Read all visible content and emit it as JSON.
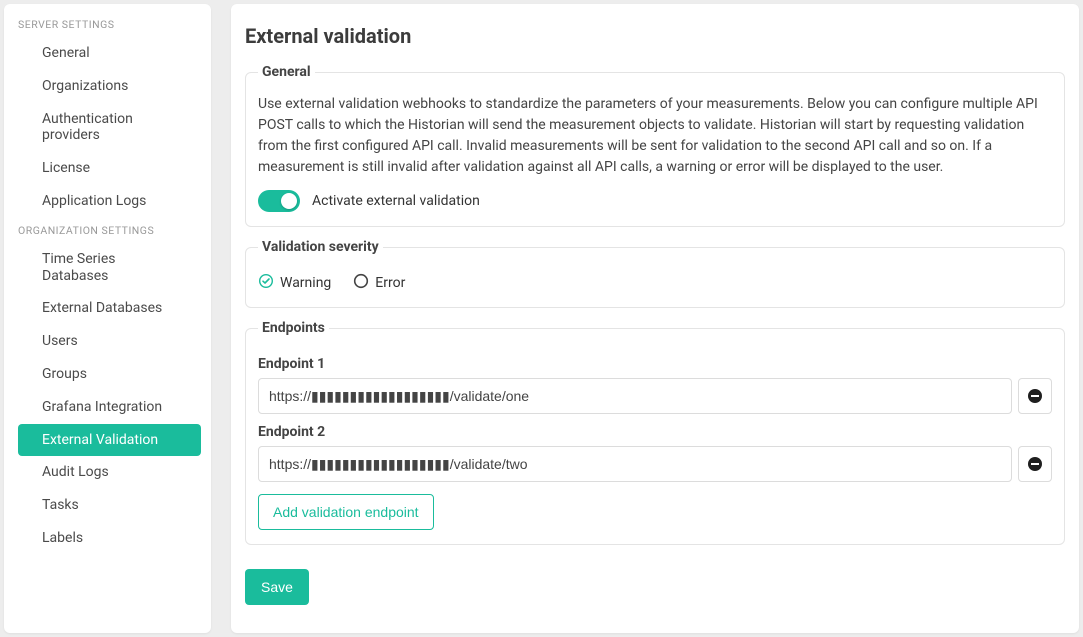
{
  "colors": {
    "accent": "#1abc9c"
  },
  "sidebar": {
    "server_header": "SERVER SETTINGS",
    "server_items": [
      {
        "label": "General"
      },
      {
        "label": "Organizations"
      },
      {
        "label": "Authentication providers"
      },
      {
        "label": "License"
      },
      {
        "label": "Application Logs"
      }
    ],
    "org_header": "ORGANIZATION SETTINGS",
    "org_items": [
      {
        "label": "Time Series Databases"
      },
      {
        "label": "External Databases"
      },
      {
        "label": "Users"
      },
      {
        "label": "Groups"
      },
      {
        "label": "Grafana Integration"
      },
      {
        "label": "External Validation",
        "active": true
      },
      {
        "label": "Audit Logs"
      },
      {
        "label": "Tasks"
      },
      {
        "label": "Labels"
      }
    ]
  },
  "page": {
    "title": "External validation",
    "general": {
      "legend": "General",
      "description": "Use external validation webhooks to standardize the parameters of your measurements. Below you can configure multiple API POST calls to which the Historian will send the measurement objects to validate. Historian will start by requesting validation from the first configured API call. Invalid measurements will be sent for validation to the second API call and so on. If a measurement is still invalid after validation against all API calls, a warning or error will be displayed to the user.",
      "toggle_label": "Activate external validation",
      "toggle_on": true
    },
    "severity": {
      "legend": "Validation severity",
      "options": [
        {
          "label": "Warning",
          "selected": true
        },
        {
          "label": "Error",
          "selected": false
        }
      ]
    },
    "endpoints": {
      "legend": "Endpoints",
      "items": [
        {
          "label": "Endpoint 1",
          "value": "https://▮▮▮▮▮▮▮▮▮▮▮▮▮▮▮▮▮▮/validate/one"
        },
        {
          "label": "Endpoint 2",
          "value": "https://▮▮▮▮▮▮▮▮▮▮▮▮▮▮▮▮▮▮/validate/two"
        }
      ],
      "add_label": "Add validation endpoint"
    },
    "save_label": "Save"
  }
}
